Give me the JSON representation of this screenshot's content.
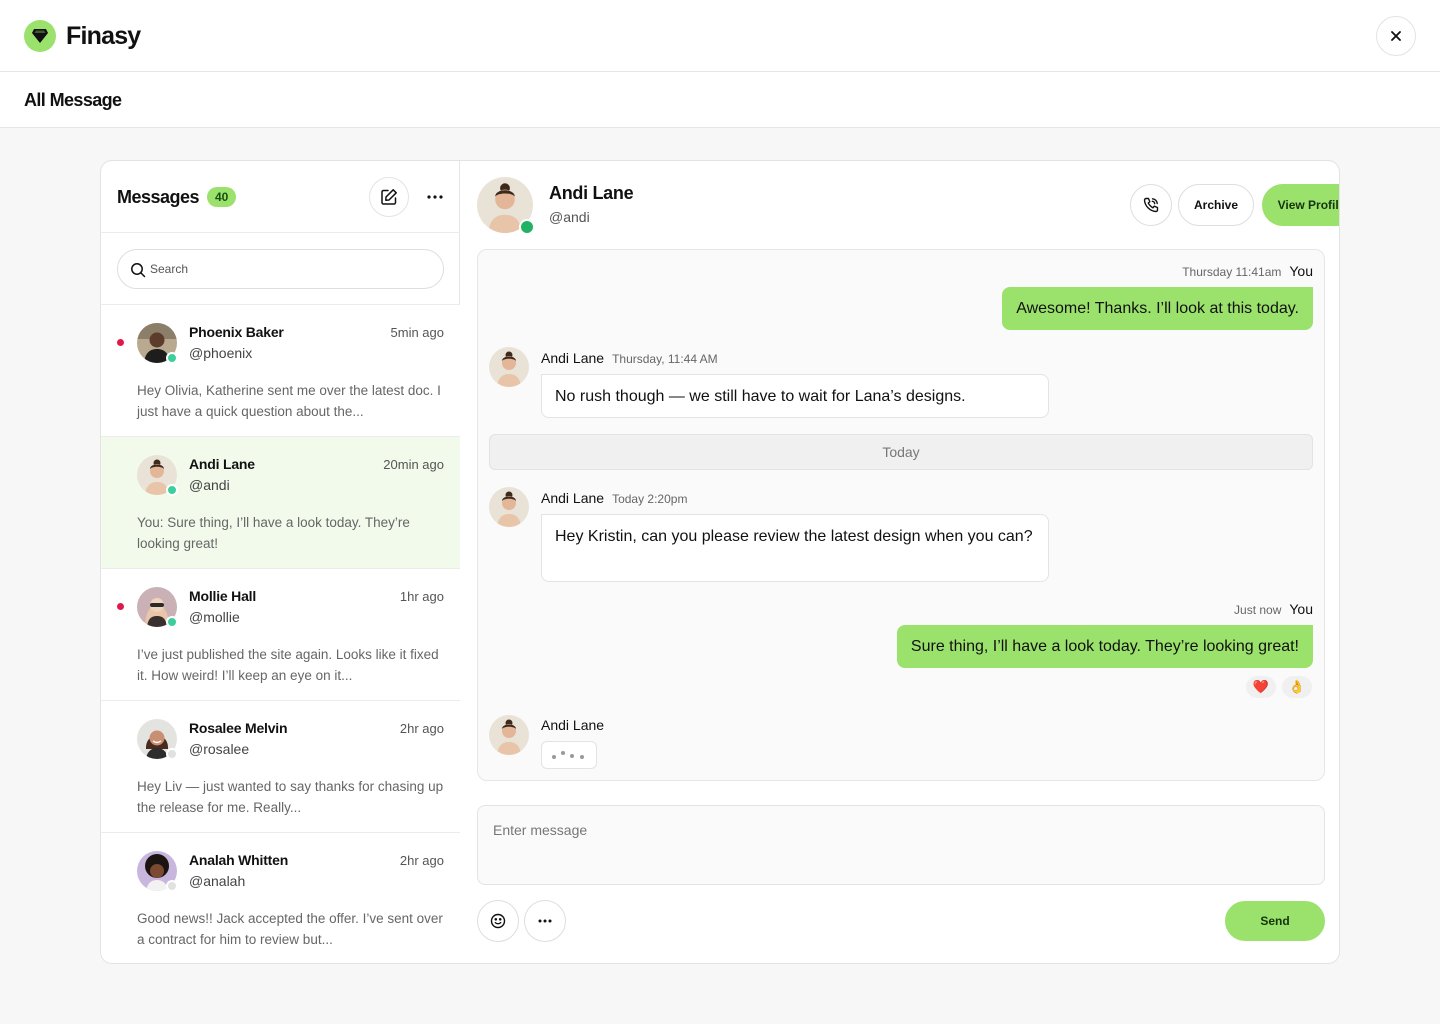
{
  "app": {
    "brand_name": "Finasy",
    "accent": "#9be26c",
    "close_icon": "close-icon"
  },
  "page": {
    "title": "All Message"
  },
  "inbox": {
    "title": "Messages",
    "count": "40",
    "compose_icon": "compose-icon",
    "more_icon": "more-horizontal-icon",
    "search_placeholder": "Search",
    "conversations": [
      {
        "name": "Phoenix Baker",
        "handle": "@phoenix",
        "time": "5min ago",
        "preview": "Hey Olivia, Katherine sent me over the latest doc. I just have a quick question about the...",
        "unread": true,
        "online": true
      },
      {
        "name": "Andi Lane",
        "handle": "@andi",
        "time": "20min ago",
        "preview": "You: Sure thing, I’ll have a look today. They’re looking great!",
        "unread": false,
        "online": true,
        "active": true
      },
      {
        "name": "Mollie Hall",
        "handle": "@mollie",
        "time": "1hr ago",
        "preview": "I’ve just published the site again. Looks like it fixed it. How weird! I’ll keep an eye on it...",
        "unread": true,
        "online": true
      },
      {
        "name": "Rosalee Melvin",
        "handle": "@rosalee",
        "time": "2hr ago",
        "preview": "Hey Liv — just wanted to say thanks for chasing up the release for me. Really...",
        "unread": false,
        "online": false
      },
      {
        "name": "Analah Whitten",
        "handle": "@analah",
        "time": "2hr ago",
        "preview": "Good news!! Jack accepted the offer. I’ve sent over a contract for him to review but...",
        "unread": false,
        "online": false
      }
    ]
  },
  "chat": {
    "contact_name": "Andi Lane",
    "contact_handle": "@andi",
    "call_icon": "phone-call-icon",
    "archive_label": "Archive",
    "view_profile_label": "View Profile",
    "more_icon": "more-horizontal-icon",
    "messages": [
      {
        "from": "You",
        "time": "Thursday 11:41am",
        "text": "Awesome! Thanks. I’ll look at this today."
      },
      {
        "from": "Andi Lane",
        "time": "Thursday, 11:44 AM",
        "text": "No rush though — we still have to wait for Lana’s designs."
      },
      {
        "from": "Andi Lane",
        "time": "Today 2:20pm",
        "text": "Hey Kristin, can you please review the latest design when you can?"
      },
      {
        "from": "You",
        "time": "Just now",
        "text": "Sure thing, I’ll have a look today. They’re looking great!",
        "reactions": [
          "❤️",
          "👌"
        ]
      }
    ],
    "divider_label": "Today",
    "typing_author": "Andi Lane",
    "composer_placeholder": "Enter message",
    "emoji_icon": "smile-icon",
    "composer_more_icon": "more-horizontal-icon",
    "send_label": "Send"
  }
}
